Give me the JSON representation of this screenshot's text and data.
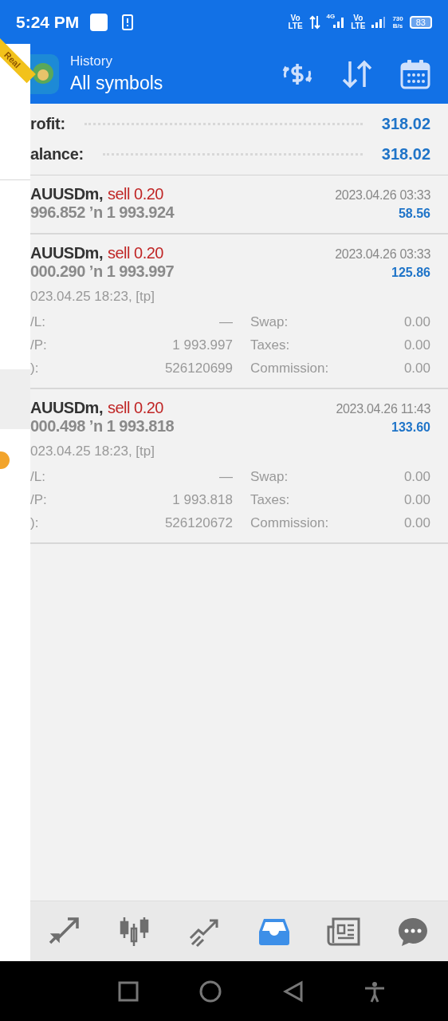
{
  "status_bar": {
    "time": "5:24 PM",
    "sim1": [
      "Vo",
      "LTE"
    ],
    "net": "4G",
    "sim2": [
      "Vo",
      "LTE"
    ],
    "speed": [
      "730",
      "B/s"
    ],
    "battery": "83"
  },
  "header": {
    "ribbon": "Real",
    "subtitle": "History",
    "title": "All symbols"
  },
  "summary": [
    {
      "label": "rofit:",
      "value": "318.02"
    },
    {
      "label": "alance:",
      "value": "318.02"
    }
  ],
  "deals": [
    {
      "symbol": "AUUSDm,",
      "side": "sell 0.20",
      "prices": "996.852 ’n  1 993.924",
      "time": "2023.04.26 03:33",
      "profit": "58.56",
      "expanded": false
    },
    {
      "symbol": "AUUSDm,",
      "side": "sell 0.20",
      "prices": "000.290 ’n  1 993.997",
      "time": "2023.04.26 03:33",
      "profit": "125.86",
      "expanded": true,
      "open": "023.04.25 18:23, [tp]",
      "rows": [
        {
          "label": "/L:",
          "value": "—",
          "label2": "Swap:",
          "value2": "0.00"
        },
        {
          "label": "/P:",
          "value": "1 993.997",
          "label2": "Taxes:",
          "value2": "0.00"
        },
        {
          "label": "):",
          "value": "526120699",
          "label2": "Commission:",
          "value2": "0.00"
        }
      ]
    },
    {
      "symbol": "AUUSDm,",
      "side": "sell 0.20",
      "prices": "000.498 ’n  1 993.818",
      "time": "2023.04.26 11:43",
      "profit": "133.60",
      "expanded": true,
      "open": "023.04.25 18:23, [tp]",
      "rows": [
        {
          "label": "/L:",
          "value": "—",
          "label2": "Swap:",
          "value2": "0.00"
        },
        {
          "label": "/P:",
          "value": "1 993.818",
          "label2": "Taxes:",
          "value2": "0.00"
        },
        {
          "label": "):",
          "value": "526120672",
          "label2": "Commission:",
          "value2": "0.00"
        }
      ]
    }
  ],
  "bottom_nav": [
    {
      "kind": "trade",
      "selected": false
    },
    {
      "kind": "chart",
      "selected": false
    },
    {
      "kind": "trend",
      "selected": false
    },
    {
      "kind": "history",
      "selected": true
    },
    {
      "kind": "news",
      "selected": false
    },
    {
      "kind": "chat",
      "selected": false
    }
  ]
}
